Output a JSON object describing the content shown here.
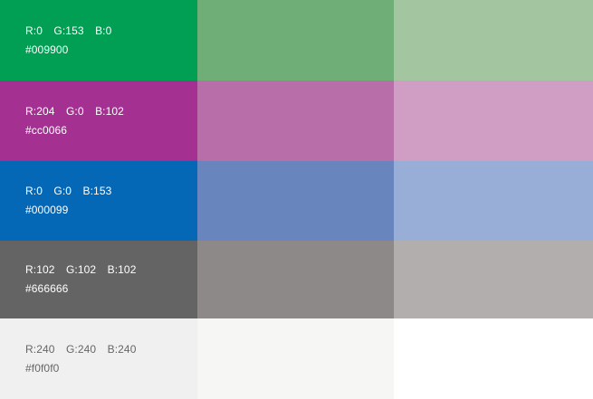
{
  "rows": [
    {
      "r": "R:0",
      "g": "G:153",
      "b": "B:0",
      "hex": "#009900",
      "text_color": "#ffffff",
      "swatches": [
        "#009f53",
        "#70ae78",
        "#a3c6a0"
      ]
    },
    {
      "r": "R:204",
      "g": "G:0",
      "b": "B:102",
      "hex": "#cc0066",
      "text_color": "#ffffff",
      "swatches": [
        "#a43192",
        "#b86ea9",
        "#d09ec5"
      ]
    },
    {
      "r": "R:0",
      "g": "G:0",
      "b": "B:153",
      "hex": "#000099",
      "text_color": "#ffffff",
      "swatches": [
        "#0568b6",
        "#6886bd",
        "#99aed7"
      ]
    },
    {
      "r": "R:102",
      "g": "G:102",
      "b": "B:102",
      "hex": "#666666",
      "text_color": "#ffffff",
      "swatches": [
        "#646464",
        "#8c8988",
        "#b2aead"
      ]
    },
    {
      "r": "R:240",
      "g": "G:240",
      "b": "B:240",
      "hex": "#f0f0f0",
      "text_color": "#666666",
      "swatches": [
        "#f0f0f0",
        "#f6f6f4",
        "#ffffff"
      ]
    }
  ]
}
